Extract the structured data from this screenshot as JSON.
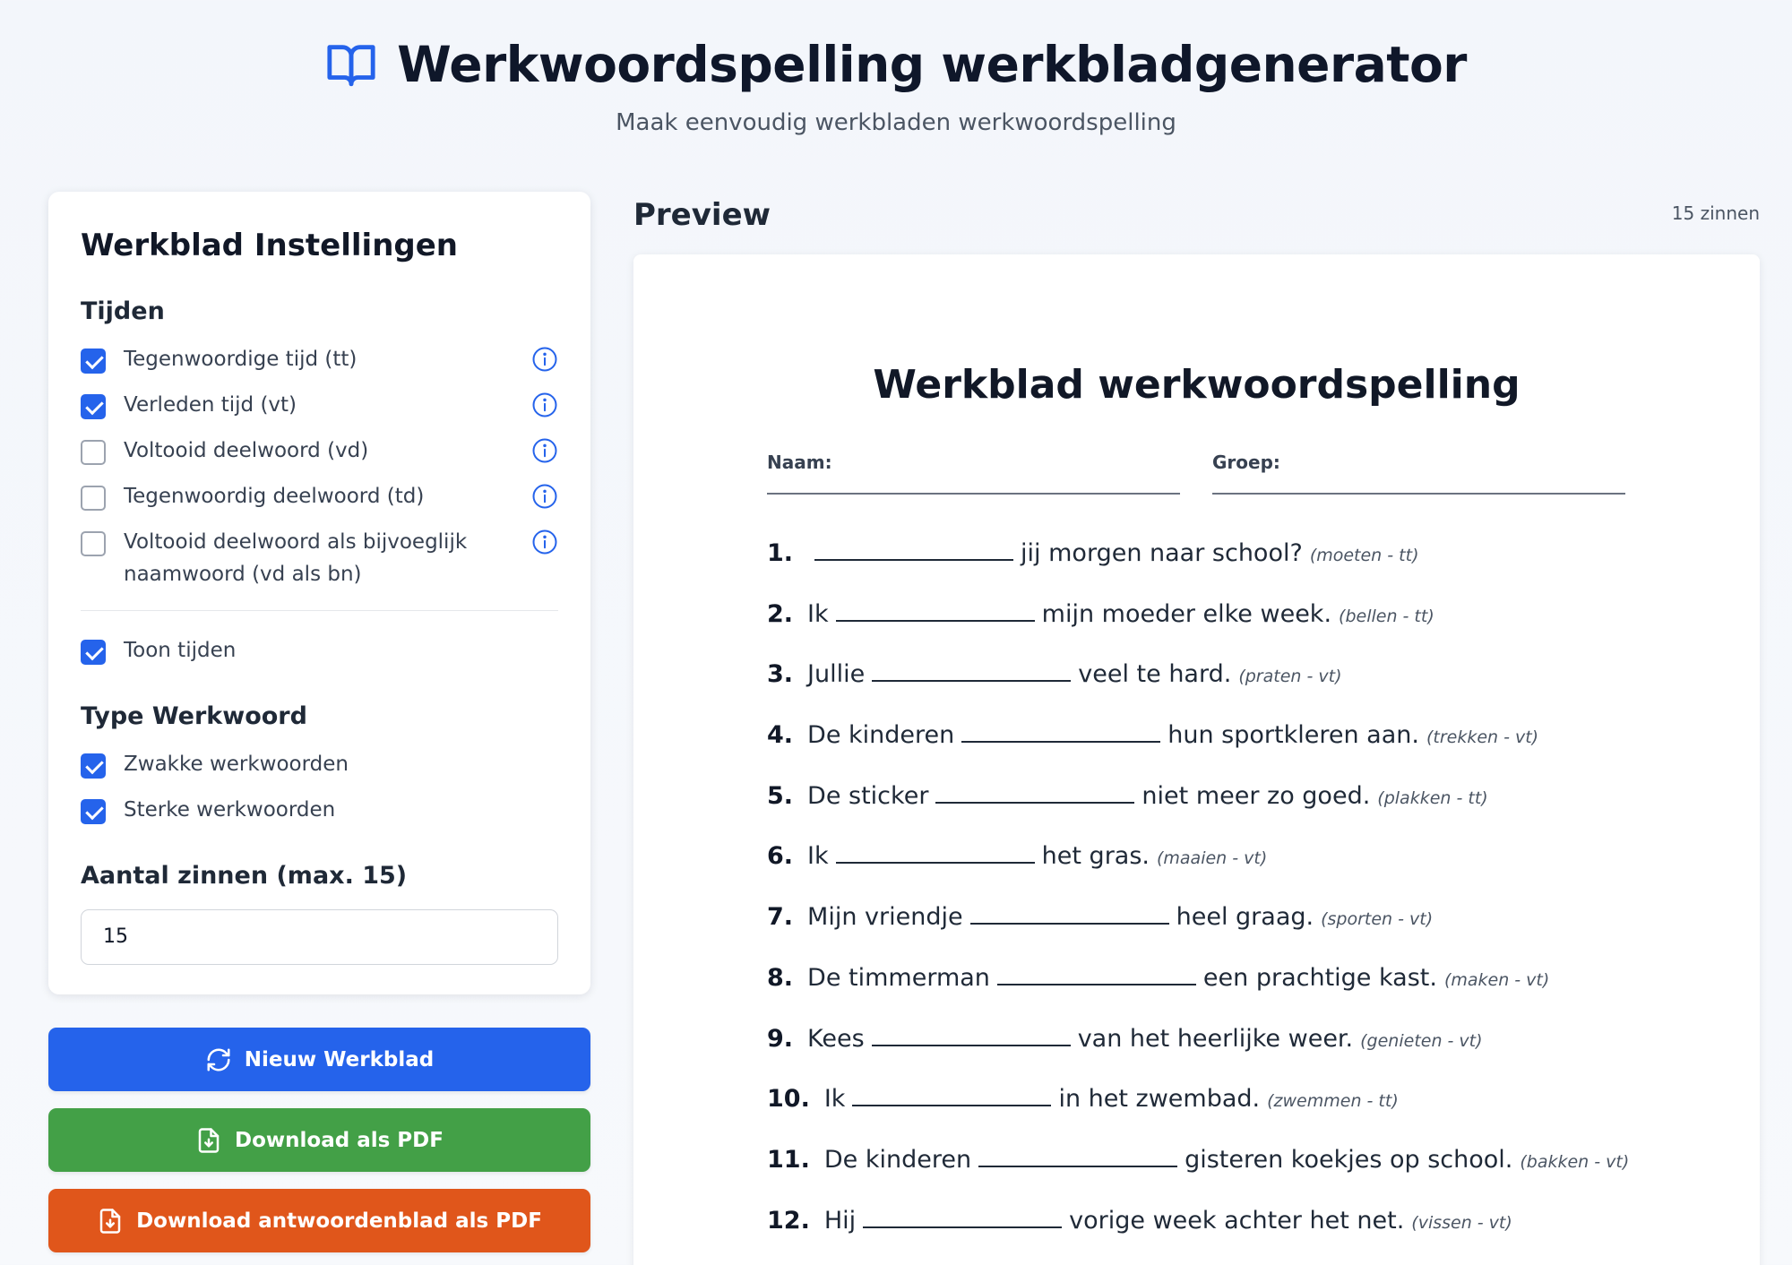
{
  "header": {
    "title": "Werkwoordspelling werkbladgenerator",
    "subtitle": "Maak eenvoudig werkbladen werkwoordspelling",
    "icon": "book-open-icon"
  },
  "settings": {
    "title": "Werkblad Instellingen",
    "tenses_title": "Tijden",
    "tenses": [
      {
        "label": "Tegenwoordige tijd (tt)",
        "checked": true
      },
      {
        "label": "Verleden tijd (vt)",
        "checked": true
      },
      {
        "label": "Voltooid deelwoord (vd)",
        "checked": false
      },
      {
        "label": "Tegenwoordig deelwoord (td)",
        "checked": false
      },
      {
        "label_line1": "Voltooid deelwoord als bijvoeglijk",
        "label_line2": "naamwoord (vd als bn)",
        "checked": false
      }
    ],
    "show_tenses": {
      "label": "Toon tijden",
      "checked": true
    },
    "verb_type_title": "Type Werkwoord",
    "verb_types": [
      {
        "label": "Zwakke werkwoorden",
        "checked": true
      },
      {
        "label": "Sterke werkwoorden",
        "checked": true
      }
    ],
    "count_title": "Aantal zinnen (max. 15)",
    "count_value": "15"
  },
  "buttons": {
    "new": "Nieuw Werkblad",
    "download_pdf": "Download als PDF",
    "download_answers": "Download antwoordenblad als PDF"
  },
  "preview": {
    "heading": "Preview",
    "count_label": "15 zinnen",
    "sheet_title": "Werkblad werkwoordspelling",
    "name_label": "Naam:",
    "group_label": "Groep:",
    "sentences": [
      {
        "num": "1.",
        "before": "",
        "after": "jij morgen naar school?",
        "hint": "(moeten - tt)"
      },
      {
        "num": "2.",
        "before": "Ik",
        "after": "mijn moeder elke week.",
        "hint": "(bellen - tt)"
      },
      {
        "num": "3.",
        "before": "Jullie",
        "after": "veel te hard.",
        "hint": "(praten - vt)"
      },
      {
        "num": "4.",
        "before": "De kinderen",
        "after": "hun sportkleren aan.",
        "hint": "(trekken - vt)"
      },
      {
        "num": "5.",
        "before": "De sticker",
        "after": "niet meer zo goed.",
        "hint": "(plakken - tt)"
      },
      {
        "num": "6.",
        "before": "Ik",
        "after": "het gras.",
        "hint": "(maaien - vt)"
      },
      {
        "num": "7.",
        "before": "Mijn vriendje",
        "after": "heel graag.",
        "hint": "(sporten - vt)"
      },
      {
        "num": "8.",
        "before": "De timmerman",
        "after": "een prachtige kast.",
        "hint": "(maken - vt)"
      },
      {
        "num": "9.",
        "before": "Kees",
        "after": "van het heerlijke weer.",
        "hint": "(genieten - vt)"
      },
      {
        "num": "10.",
        "before": "Ik",
        "after": "in het zwembad.",
        "hint": "(zwemmen - tt)"
      },
      {
        "num": "11.",
        "before": "De kinderen",
        "after": "gisteren koekjes op school.",
        "hint": "(bakken - vt)"
      },
      {
        "num": "12.",
        "before": "Hij",
        "after": "vorige week achter het net.",
        "hint": "(vissen - vt)"
      }
    ]
  },
  "colors": {
    "primary": "#2563eb",
    "success": "#43a047",
    "warning": "#e0561b"
  }
}
